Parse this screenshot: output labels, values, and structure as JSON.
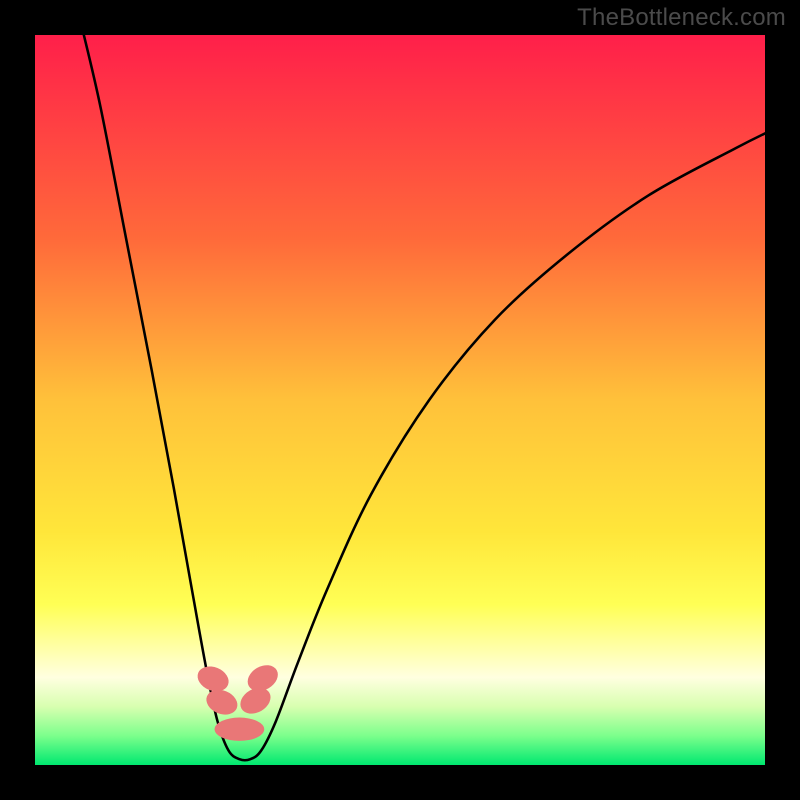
{
  "watermark": "TheBottleneck.com",
  "chart_data": {
    "type": "line",
    "title": "",
    "xlabel": "",
    "ylabel": "",
    "xlim": [
      0,
      100
    ],
    "ylim": [
      0,
      100
    ],
    "gradient_stops": [
      {
        "pct": 0,
        "color": "#ff1f4a"
      },
      {
        "pct": 28,
        "color": "#ff6a3a"
      },
      {
        "pct": 50,
        "color": "#ffc13a"
      },
      {
        "pct": 68,
        "color": "#ffe63a"
      },
      {
        "pct": 78,
        "color": "#ffff55"
      },
      {
        "pct": 84,
        "color": "#ffffa8"
      },
      {
        "pct": 88,
        "color": "#ffffe0"
      },
      {
        "pct": 92,
        "color": "#d8ffb0"
      },
      {
        "pct": 96,
        "color": "#7cff8c"
      },
      {
        "pct": 100,
        "color": "#00e870"
      }
    ],
    "series": [
      {
        "name": "bottleneck-curve",
        "points": [
          {
            "x": 6.5,
            "y": 100.8
          },
          {
            "x": 9.0,
            "y": 90.0
          },
          {
            "x": 12.5,
            "y": 72.0
          },
          {
            "x": 16.0,
            "y": 54.0
          },
          {
            "x": 19.0,
            "y": 38.0
          },
          {
            "x": 21.5,
            "y": 24.0
          },
          {
            "x": 23.5,
            "y": 13.0
          },
          {
            "x": 25.0,
            "y": 6.0
          },
          {
            "x": 26.5,
            "y": 2.0
          },
          {
            "x": 28.0,
            "y": 0.8
          },
          {
            "x": 29.5,
            "y": 0.8
          },
          {
            "x": 31.0,
            "y": 2.0
          },
          {
            "x": 33.0,
            "y": 6.0
          },
          {
            "x": 36.0,
            "y": 14.0
          },
          {
            "x": 40.0,
            "y": 24.0
          },
          {
            "x": 46.0,
            "y": 37.0
          },
          {
            "x": 54.0,
            "y": 50.0
          },
          {
            "x": 63.0,
            "y": 61.0
          },
          {
            "x": 73.0,
            "y": 70.0
          },
          {
            "x": 84.0,
            "y": 78.0
          },
          {
            "x": 96.0,
            "y": 84.5
          },
          {
            "x": 101.0,
            "y": 87.0
          }
        ]
      }
    ],
    "markers": [
      {
        "name": "left-upper",
        "cx": 24.4,
        "cy": 11.8,
        "rx": 1.6,
        "ry": 2.2,
        "rot": -68
      },
      {
        "name": "left-lower",
        "cx": 25.6,
        "cy": 8.6,
        "rx": 1.6,
        "ry": 2.2,
        "rot": -68
      },
      {
        "name": "right-upper",
        "cx": 31.2,
        "cy": 11.9,
        "rx": 1.6,
        "ry": 2.2,
        "rot": 60
      },
      {
        "name": "right-lower",
        "cx": 30.2,
        "cy": 8.8,
        "rx": 1.6,
        "ry": 2.2,
        "rot": 60
      },
      {
        "name": "bottom",
        "cx": 28.0,
        "cy": 4.9,
        "rx": 3.4,
        "ry": 1.6,
        "rot": 0
      }
    ],
    "marker_color": "#e97777",
    "curve_color": "#000000"
  }
}
